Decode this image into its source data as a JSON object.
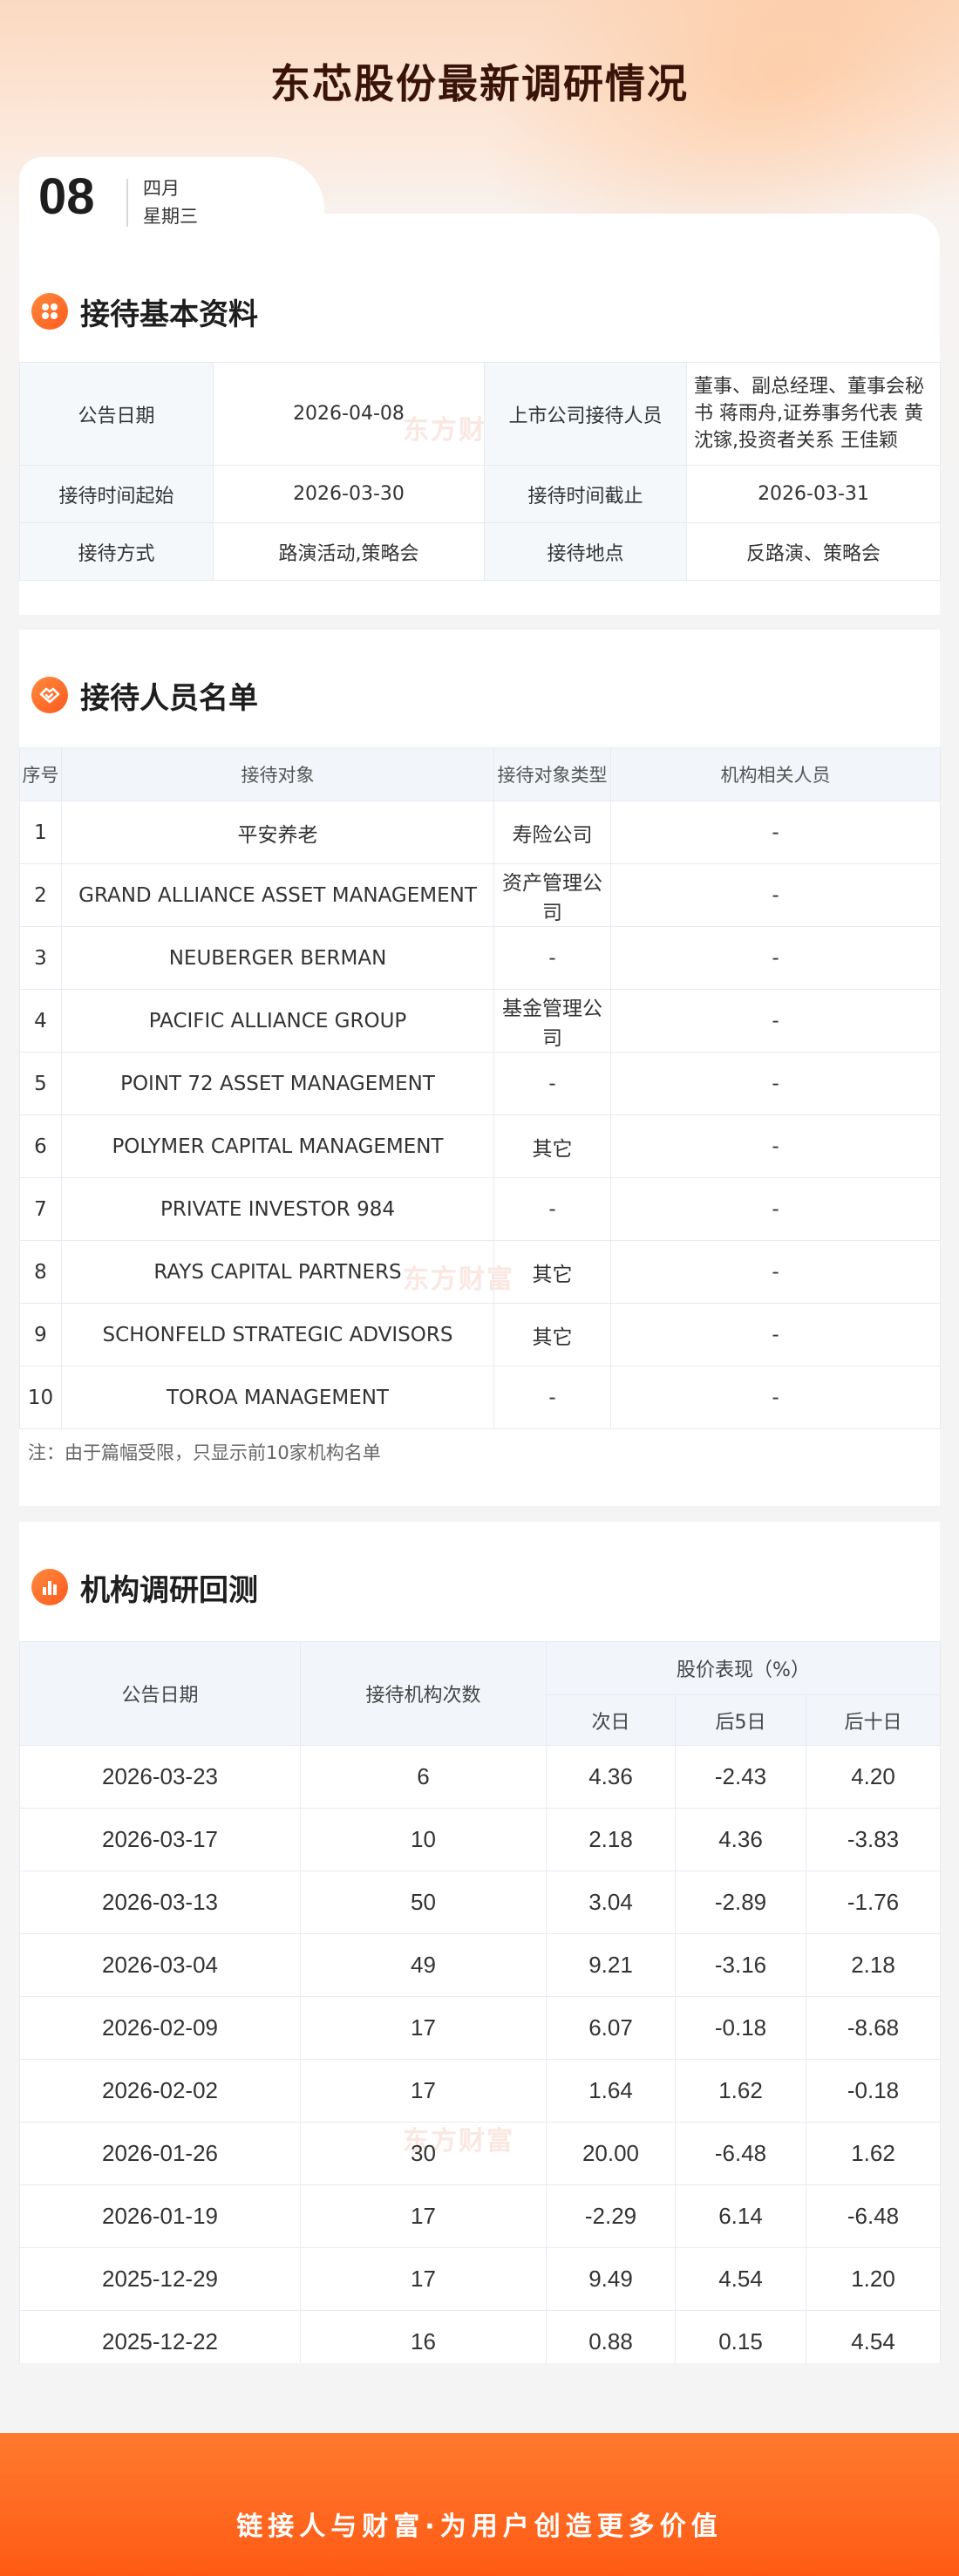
{
  "title": "东芯股份最新调研情况",
  "date": {
    "day": "08",
    "month": "四月",
    "weekday": "星期三"
  },
  "watermark": "东方财富",
  "basic": {
    "section_title": "接待基本资料",
    "rows": [
      {
        "l1": "公告日期",
        "v1": "2026-04-08",
        "l2": "上市公司接待人员",
        "v2": "董事、副总经理、董事会秘书 蒋雨舟,证券事务代表 黄沈镓,投资者关系 王佳颖"
      },
      {
        "l1": "接待时间起始",
        "v1": "2026-03-30",
        "l2": "接待时间截止",
        "v2": "2026-03-31"
      },
      {
        "l1": "接待方式",
        "v1": "路演活动,策略会",
        "l2": "接待地点",
        "v2": "反路演、策略会"
      }
    ]
  },
  "people": {
    "section_title": "接待人员名单",
    "headers": [
      "序号",
      "接待对象",
      "接待对象类型",
      "机构相关人员"
    ],
    "rows": [
      [
        "1",
        "平安养老",
        "寿险公司",
        "-"
      ],
      [
        "2",
        "GRAND ALLIANCE ASSET MANAGEMENT",
        "资产管理公司",
        "-"
      ],
      [
        "3",
        "NEUBERGER BERMAN",
        "-",
        "-"
      ],
      [
        "4",
        "PACIFIC ALLIANCE GROUP",
        "基金管理公司",
        "-"
      ],
      [
        "5",
        "POINT 72 ASSET MANAGEMENT",
        "-",
        "-"
      ],
      [
        "6",
        "POLYMER CAPITAL MANAGEMENT",
        "其它",
        "-"
      ],
      [
        "7",
        "PRIVATE INVESTOR 984",
        "-",
        "-"
      ],
      [
        "8",
        "RAYS CAPITAL PARTNERS",
        "其它",
        "-"
      ],
      [
        "9",
        "SCHONFELD STRATEGIC ADVISORS",
        "其它",
        "-"
      ],
      [
        "10",
        "TOROA MANAGEMENT",
        "-",
        "-"
      ]
    ],
    "note": "注：由于篇幅受限，只显示前10家机构名单"
  },
  "review": {
    "section_title": "机构调研回测",
    "headers": {
      "date": "公告日期",
      "count": "接待机构次数",
      "perf": "股价表现（%）",
      "d1": "次日",
      "d5": "后5日",
      "d10": "后十日"
    },
    "rows": [
      [
        "2026-03-23",
        "6",
        "4.36",
        "-2.43",
        "4.20"
      ],
      [
        "2026-03-17",
        "10",
        "2.18",
        "4.36",
        "-3.83"
      ],
      [
        "2026-03-13",
        "50",
        "3.04",
        "-2.89",
        "-1.76"
      ],
      [
        "2026-03-04",
        "49",
        "9.21",
        "-3.16",
        "2.18"
      ],
      [
        "2026-02-09",
        "17",
        "6.07",
        "-0.18",
        "-8.68"
      ],
      [
        "2026-02-02",
        "17",
        "1.64",
        "1.62",
        "-0.18"
      ],
      [
        "2026-01-26",
        "30",
        "20.00",
        "-6.48",
        "1.62"
      ],
      [
        "2026-01-19",
        "17",
        "-2.29",
        "6.14",
        "-6.48"
      ],
      [
        "2025-12-29",
        "17",
        "9.49",
        "4.54",
        "1.20"
      ],
      [
        "2025-12-22",
        "16",
        "0.88",
        "0.15",
        "4.54"
      ]
    ]
  },
  "footer": "链接人与财富·为用户创造更多价值",
  "colors": {
    "accent": "#ff5a1f",
    "title": "#3a1408",
    "header_bg": "#f2f6fb"
  }
}
